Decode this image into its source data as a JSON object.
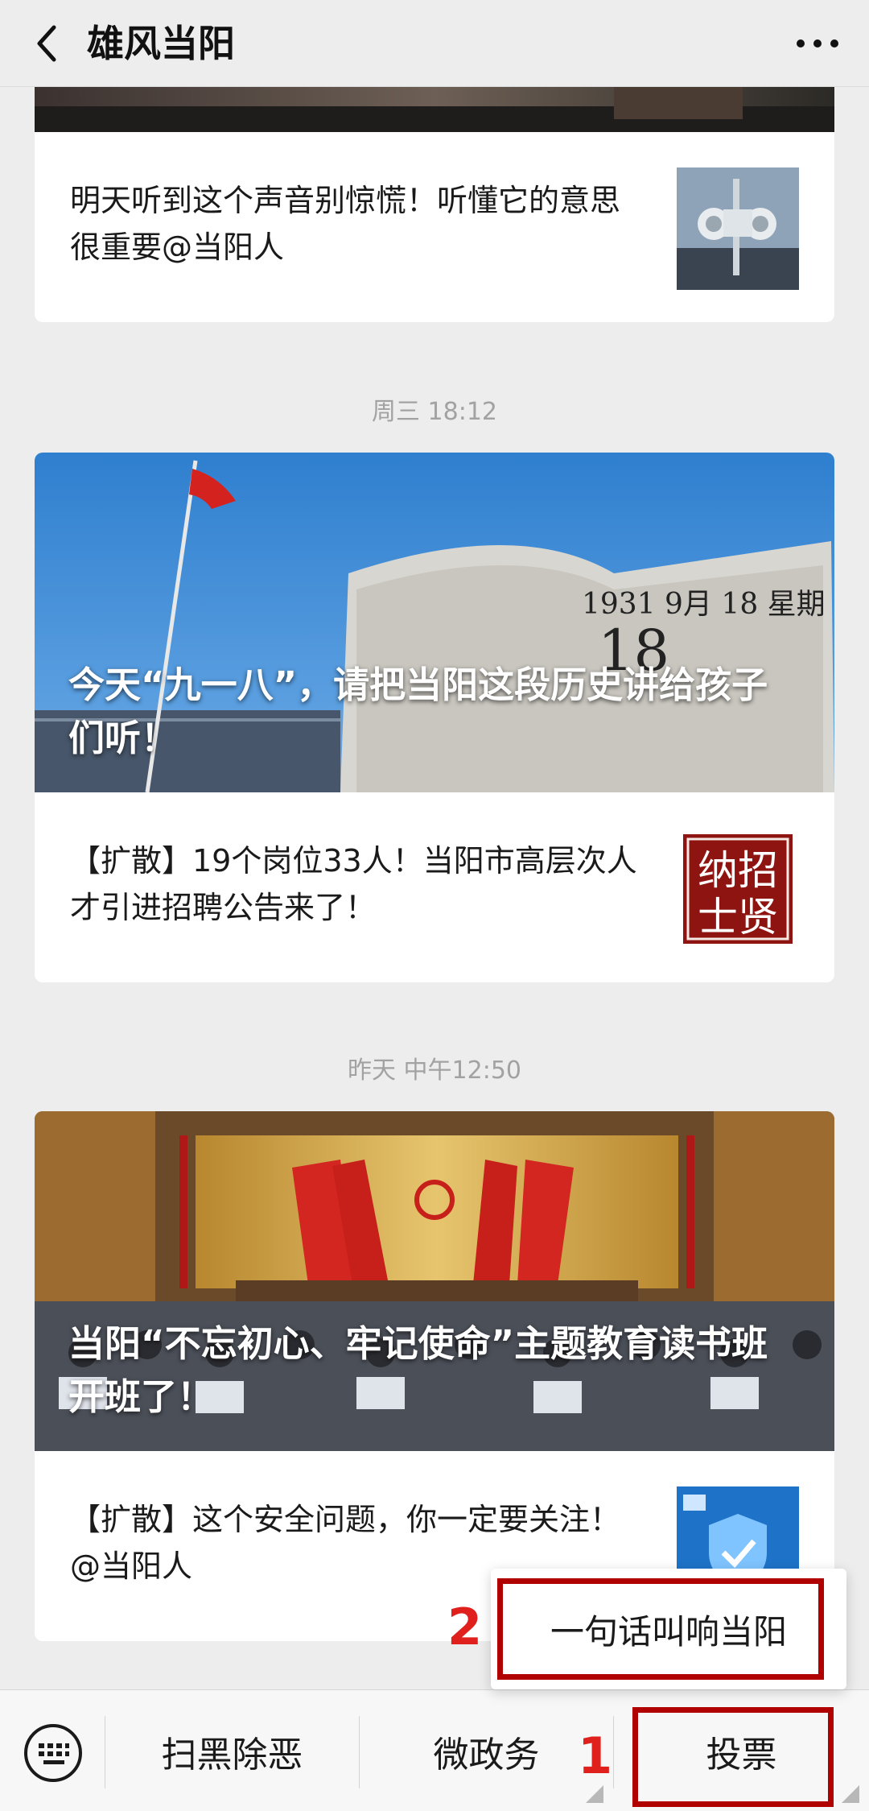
{
  "header": {
    "title": "雄风当阳"
  },
  "feed": {
    "block1": {
      "row_text": "明天听到这个声音别惊慌！听懂它的意思很重要@当阳人"
    },
    "block2": {
      "timestamp": "周三 18:12",
      "hero_title": "今天“九一八”，请把当阳这段历史讲给孩子们听！",
      "hero_monument_text": "1931 9月 18 星期",
      "row_text": "【扩散】19个岗位33人！当阳市高层次人才引进招聘公告来了！",
      "thumb_text": "纳招士贤"
    },
    "block3": {
      "timestamp": "昨天 中午12:50",
      "hero_title": "当阳“不忘初心、牢记使命”主题教育读书班开班了！",
      "row_text": "【扩散】这个安全问题，你一定要关注！@当阳人"
    }
  },
  "popup": {
    "item": "一句话叫响当阳"
  },
  "menu": {
    "items": [
      "扫黑除恶",
      "微政务",
      "投票"
    ]
  },
  "annotations": {
    "label_1": "1",
    "label_2": "2"
  },
  "colors": {
    "annotation_red": "#b00000",
    "annotation_number": "#e0201c",
    "background": "#ededed"
  }
}
